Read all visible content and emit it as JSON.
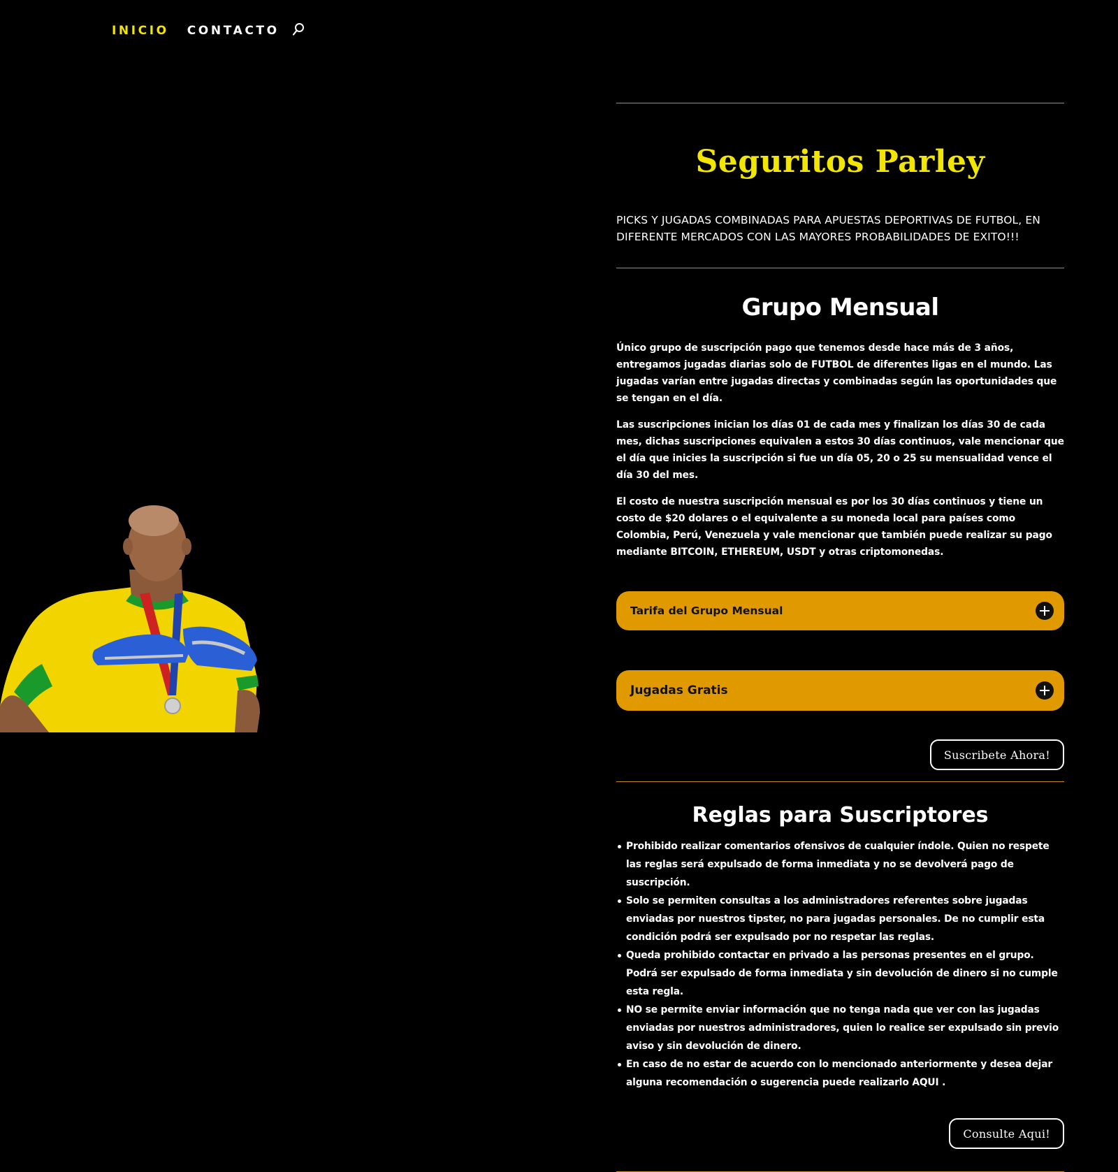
{
  "nav": {
    "items": [
      {
        "label": "INICIO",
        "active": true
      },
      {
        "label": "CONTACTO",
        "active": false
      }
    ],
    "search_icon": "search-icon"
  },
  "hero": {
    "image_description_icon": "player-photo"
  },
  "brand": {
    "title": "Seguritos Parley",
    "tagline": "PICKS Y JUGADAS COMBINADAS PARA APUESTAS DEPORTIVAS DE FUTBOL, EN DIFERENTE MERCADOS CON LAS MAYORES PROBABILIDADES DE EXITO!!!"
  },
  "group": {
    "heading": "Grupo Mensual",
    "paragraphs": [
      "Único grupo de suscripción pago que tenemos desde hace más de 3 años, entregamos jugadas diarias solo de FUTBOL de diferentes ligas en el mundo. Las jugadas varían entre jugadas directas y combinadas según las oportunidades que se tengan en el día.",
      "Las suscripciones inician los días 01 de cada mes y finalizan los días 30 de cada mes, dichas suscripciones equivalen a estos 30 días continuos, vale mencionar que el día que inicies la suscripción si fue un día 05, 20 o 25 su mensualidad vence el día 30 del mes.",
      "El costo de nuestra suscripción mensual es por los 30 días continuos y tiene un costo de $20 dolares o el equivalente a su moneda local para países como Colombia, Perú, Venezuela y vale mencionar que también puede realizar su pago mediante BITCOIN, ETHEREUM, USDT y otras criptomonedas."
    ],
    "accordions": [
      {
        "label": "Tarifa del Grupo Mensual",
        "icon": "plus-circle-icon"
      },
      {
        "label": "Jugadas Gratis",
        "icon": "plus-circle-icon"
      }
    ],
    "subscribe_label": "Suscribete Ahora!"
  },
  "rules": {
    "heading": "Reglas para Suscriptores",
    "items": [
      "Prohibido realizar comentarios ofensivos de cualquier índole. Quien no respete las reglas será expulsado de forma inmediata y no se devolverá pago de suscripción.",
      "Solo se permiten consultas a los administradores referentes sobre jugadas enviadas por nuestros tipster, no para jugadas personales. De no cumplir esta condición podrá ser expulsado por no respetar las reglas.",
      "Queda prohibido contactar en privado a las personas presentes en el grupo. Podrá ser expulsado de forma inmediata y sin devolución de dinero si no cumple esta regla.",
      "NO se permite enviar información que no tenga nada que ver con las jugadas enviadas por nuestros administradores, quien lo realice ser expulsado sin previo aviso y sin devolución de dinero.",
      "En caso de no estar de acuerdo con lo mencionado anteriormente y desea dejar alguna recomendación o sugerencia puede realizarlo AQUI ."
    ],
    "consult_label": "Consulte Aqui!"
  },
  "colors": {
    "accent_yellow": "#f2e600",
    "accordion_orange": "#e09a00",
    "divider": "#c98a18",
    "background": "#000000"
  }
}
